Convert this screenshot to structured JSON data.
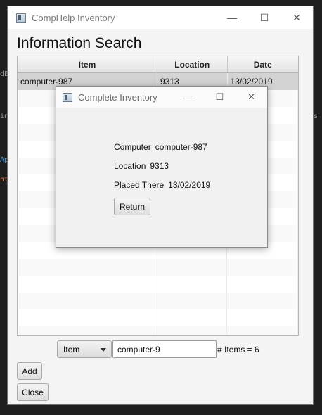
{
  "main_window": {
    "title": "CompHelp Inventory",
    "heading": "Information Search",
    "controls": {
      "minimize": "—",
      "maximize": "☐",
      "close": "✕"
    }
  },
  "table": {
    "columns": [
      "Item",
      "Location",
      "Date"
    ],
    "rows": [
      [
        "computer-987",
        "9313",
        "13/02/2019"
      ]
    ],
    "selected_row": 0,
    "empty_row_count": 15
  },
  "search": {
    "field_selector": "Item",
    "query": "computer-9",
    "items_count_label": "# Items = 6"
  },
  "buttons": {
    "add": "Add",
    "close": "Close"
  },
  "dialog": {
    "title": "Complete Inventory",
    "controls": {
      "minimize": "—",
      "maximize": "☐",
      "close": "✕"
    },
    "computer_label": "Computer",
    "computer_value": "computer-987",
    "location_label": "Location",
    "location_value": "9313",
    "placed_label": "Placed There",
    "placed_value": "13/02/2019",
    "return_button": "Return"
  }
}
